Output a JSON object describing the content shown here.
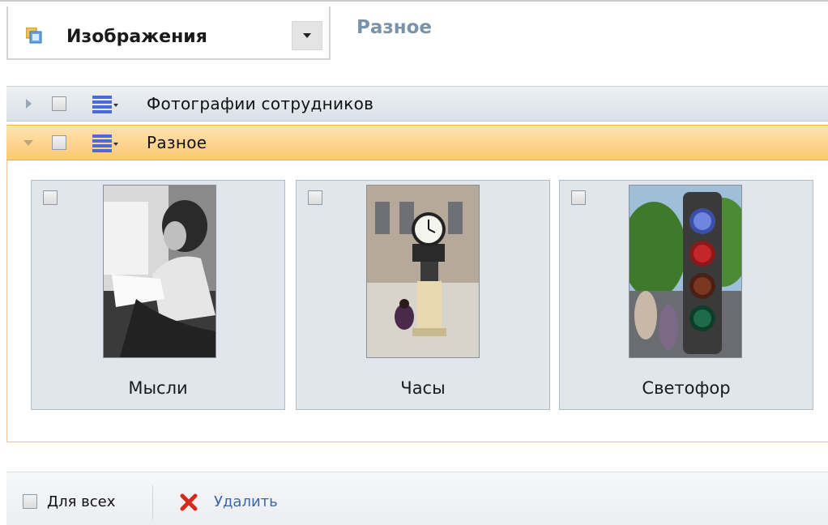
{
  "selector": {
    "label": "Изображения",
    "icon": "images-icon"
  },
  "group_title": "Разное",
  "groups": [
    {
      "label": "Фотографии сотрудников",
      "expanded": false,
      "checked": false
    },
    {
      "label": "Разное",
      "expanded": true,
      "checked": false
    }
  ],
  "images": [
    {
      "caption": "Мысли",
      "checked": false
    },
    {
      "caption": "Часы",
      "checked": false
    },
    {
      "caption": "Светофор",
      "checked": false
    }
  ],
  "footer": {
    "for_all_label": "Для всех",
    "delete_label": "Удалить"
  },
  "colors": {
    "accent_row": "#fcc874",
    "link": "#3a68a8",
    "title": "#7b93a9"
  }
}
